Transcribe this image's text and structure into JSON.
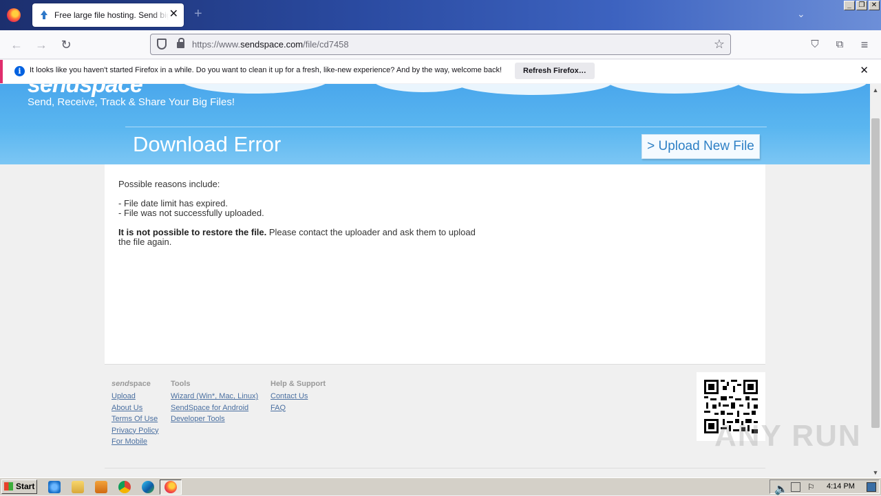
{
  "browser": {
    "tab_title": "Free large file hosting. Send big files",
    "url_prefix": "https://www.",
    "url_host": "sendspace.com",
    "url_path": "/file/cd7458",
    "notification_text": "It looks like you haven't started Firefox in a while. Do you want to clean it up for a fresh, like-new experience? And by the way, welcome back!",
    "notification_button": "Refresh Firefox…",
    "window_buttons": [
      "_",
      "❐",
      "✕"
    ]
  },
  "page": {
    "logo_partial": "sendspace",
    "tagline": "Send, Receive, Track & Share Your Big Files!",
    "title": "Download Error",
    "upload_button": "> Upload New File",
    "reasons_heading": "Possible reasons include:",
    "reasons": [
      "- File date limit has expired.",
      "- File was not successfully uploaded."
    ],
    "final_bold": "It is not possible to restore the file.",
    "final_text": " Please contact the uploader and ask them to upload the file again."
  },
  "footer": {
    "brand_italic": "send",
    "brand_rest": "space",
    "brand_links": [
      "Upload",
      "About Us",
      "Terms Of Use",
      "Privacy Policy",
      "For Mobile"
    ],
    "tools_heading": "Tools",
    "tools_links": [
      "Wizard (Win*, Mac, Linux)",
      "SendSpace for Android",
      "Developer Tools"
    ],
    "help_heading": "Help & Support",
    "help_links": [
      "Contact Us",
      "FAQ"
    ]
  },
  "watermark": "ANY RUN",
  "taskbar": {
    "start_label": "Start",
    "time": "4:14 PM"
  },
  "colors": {
    "hero_blue": "#4aa7ec",
    "link_blue": "#4a6fa0",
    "notif_accent": "#e02e6d"
  }
}
